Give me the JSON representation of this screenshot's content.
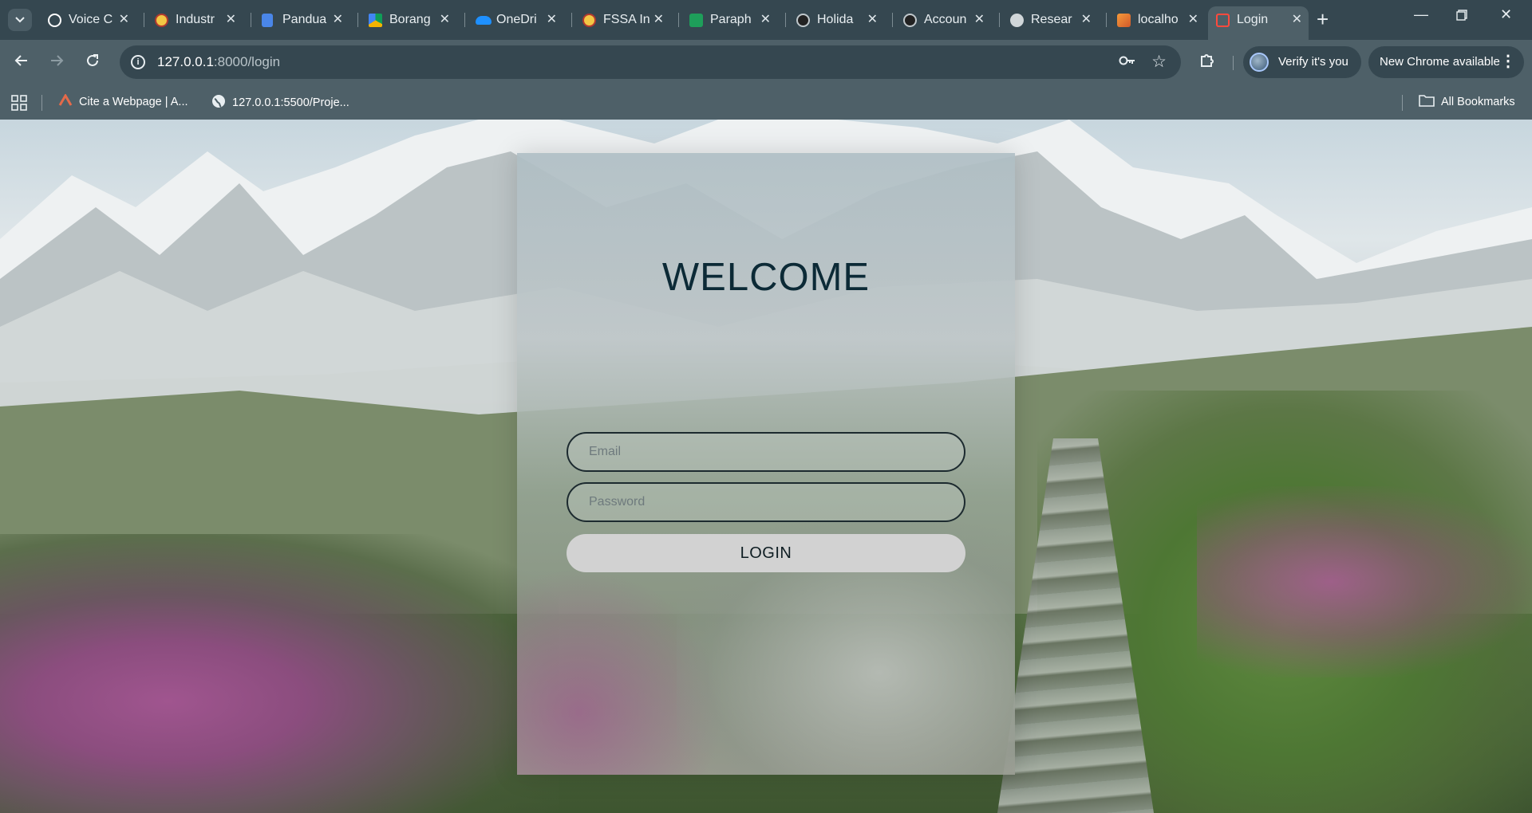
{
  "browser": {
    "tabs": [
      {
        "title": "Voice C",
        "icon": "openai-icon",
        "color": "#ffffff"
      },
      {
        "title": "Industr",
        "icon": "university-crest-icon",
        "color": "#f3c744"
      },
      {
        "title": "Pandua",
        "icon": "google-docs-icon",
        "color": "#4a86e8"
      },
      {
        "title": "Borang",
        "icon": "google-drive-icon",
        "color": "#f4b400"
      },
      {
        "title": "OneDri",
        "icon": "onedrive-icon",
        "color": "#1e90ff"
      },
      {
        "title": "FSSA In",
        "icon": "university-crest-icon",
        "color": "#f3c744"
      },
      {
        "title": "Paraph",
        "icon": "paraphrase-icon",
        "color": "#1e9e5a"
      },
      {
        "title": "Holida",
        "icon": "openai-icon",
        "color": "#ffffff"
      },
      {
        "title": "Accoun",
        "icon": "openai-icon",
        "color": "#ffffff"
      },
      {
        "title": "Resear",
        "icon": "globe-icon",
        "color": "#d0d6d9"
      },
      {
        "title": "localho",
        "icon": "xampp-icon",
        "color": "#f59b3a"
      },
      {
        "title": "Login",
        "icon": "laravel-icon",
        "color": "#ff4a3d",
        "active": true
      }
    ],
    "url_host": "127.0.0.1",
    "url_path": ":8000/login",
    "verify_label": "Verify it's you",
    "update_label": "New Chrome available"
  },
  "bookmarks": {
    "items": [
      {
        "label": "Cite a Webpage | A...",
        "icon": "cite-icon"
      },
      {
        "label": "127.0.0.1:5500/Proje...",
        "icon": "globe-icon"
      }
    ],
    "all_label": "All Bookmarks"
  },
  "login": {
    "heading": "WELCOME",
    "email_placeholder": "Email",
    "password_placeholder": "Password",
    "button_label": "LOGIN"
  }
}
